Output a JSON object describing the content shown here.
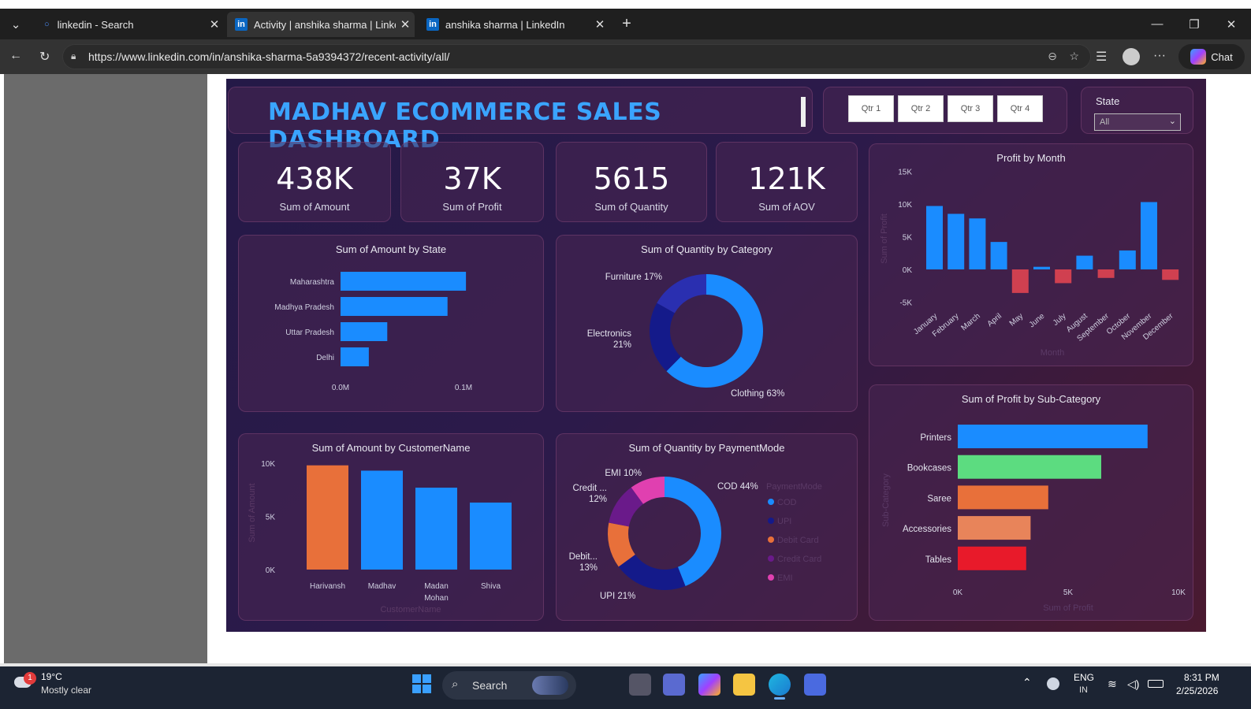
{
  "browser": {
    "tabs": [
      {
        "label": "linkedin - Search",
        "active": false
      },
      {
        "label": "Activity | anshika sharma | LinkedIn",
        "active": true
      },
      {
        "label": "anshika sharma | LinkedIn",
        "active": false
      }
    ],
    "url": "https://www.linkedin.com/in/anshika-sharma-5a9394372/recent-activity/all/",
    "chat_label": "Chat"
  },
  "dashboard": {
    "title": "MADHAV ECOMMERCE SALES DASHBOARD",
    "quarters": [
      "Qtr 1",
      "Qtr 2",
      "Qtr 3",
      "Qtr 4"
    ],
    "state_filter": {
      "label": "State",
      "value": "All"
    },
    "kpis": [
      {
        "value": "438K",
        "label": "Sum of Amount"
      },
      {
        "value": "37K",
        "label": "Sum of Profit"
      },
      {
        "value": "5615",
        "label": "Sum of Quantity"
      },
      {
        "value": "121K",
        "label": "Sum of AOV"
      }
    ]
  },
  "chart_data": [
    {
      "type": "bar",
      "orientation": "horizontal",
      "title": "Sum of Amount by State",
      "categories": [
        "Maharashtra",
        "Madhya Pradesh",
        "Uttar Pradesh",
        "Delhi"
      ],
      "values": [
        0.102,
        0.087,
        0.038,
        0.023
      ],
      "tick_labels": [
        "0.0M",
        "0.1M"
      ],
      "colors": [
        "#1a8cff"
      ]
    },
    {
      "type": "pie",
      "donut": true,
      "title": "Sum of Quantity by Category",
      "labels": [
        "Furniture 17%",
        "Electronics\n21%",
        "Clothing 63%"
      ],
      "categories": [
        "Furniture",
        "Electronics",
        "Clothing"
      ],
      "values": [
        17,
        21,
        63
      ],
      "colors": [
        "#2a2fb0",
        "#141a8a",
        "#1a8cff"
      ]
    },
    {
      "type": "bar",
      "title": "Profit by Month",
      "categories": [
        "January",
        "February",
        "March",
        "April",
        "May",
        "June",
        "July",
        "August",
        "September",
        "October",
        "November",
        "December"
      ],
      "values": [
        9700,
        8500,
        7800,
        4200,
        -3600,
        400,
        -2100,
        2100,
        -1300,
        2900,
        10300,
        -1600
      ],
      "tick_labels": [
        "15K",
        "10K",
        "5K",
        "0K",
        "-5K"
      ],
      "ylim": [
        -5000,
        15000
      ],
      "xlabel": "Month",
      "ylabel": "Sum of Profit",
      "colors": {
        "positive": "#1a8cff",
        "negative": "#d04050"
      }
    },
    {
      "type": "bar",
      "title": "Sum of Amount by CustomerName",
      "categories": [
        "Harivansh",
        "Madhav",
        "Madan Mohan",
        "Shiva"
      ],
      "values": [
        9800,
        9300,
        7700,
        6300
      ],
      "tick_labels": [
        "10K",
        "5K",
        "0K"
      ],
      "ylim": [
        0,
        10000
      ],
      "xlabel": "CustomerName",
      "ylabel": "Sum of Amount",
      "colors": [
        "#e8703a",
        "#1a8cff",
        "#1a8cff",
        "#1a8cff"
      ]
    },
    {
      "type": "pie",
      "donut": true,
      "title": "Sum of Quantity by PaymentMode",
      "labels": [
        "COD 44%",
        "UPI 21%",
        "Debit...\n13%",
        "Credit ...\n12%",
        "EMI 10%"
      ],
      "categories": [
        "COD",
        "UPI",
        "Debit Card",
        "Credit Card",
        "EMI"
      ],
      "values": [
        44,
        21,
        13,
        12,
        10
      ],
      "legend_title": "PaymentMode",
      "legend": [
        "COD",
        "UPI",
        "Debit Card",
        "Credit Card",
        "EMI"
      ],
      "colors": [
        "#1a8cff",
        "#141a8a",
        "#e8703a",
        "#6a1a8a",
        "#e040b0"
      ]
    },
    {
      "type": "bar",
      "orientation": "horizontal",
      "title": "Sum of Profit by Sub-Category",
      "categories": [
        "Printers",
        "Bookcases",
        "Saree",
        "Accessories",
        "Tables"
      ],
      "values": [
        8600,
        6500,
        4100,
        3300,
        3100
      ],
      "tick_labels": [
        "0K",
        "5K",
        "10K"
      ],
      "xlim": [
        0,
        10000
      ],
      "xlabel": "Sum of Profit",
      "ylabel": "Sub-Category",
      "colors": [
        "#1a8cff",
        "#5cdc80",
        "#e8703a",
        "#e8845a",
        "#e81a2a"
      ]
    }
  ],
  "taskbar": {
    "weather_temp": "19°C",
    "weather_desc": "Mostly clear",
    "weather_badge": "1",
    "search_placeholder": "Search",
    "lang": "ENG",
    "region": "IN",
    "time": "8:31 PM",
    "date": "2/25/2026"
  }
}
